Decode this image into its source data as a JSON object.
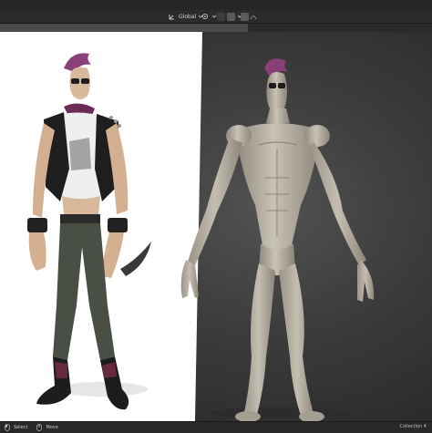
{
  "header": {
    "transform_orientation": "Global"
  },
  "statusbar": {
    "select_label": "Select",
    "move_label": "Move",
    "collection_label": "Collection 4"
  },
  "colors": {
    "reference_background": "#ffffff",
    "viewport_background": "#3a3a3a",
    "sculpt_clay": "#b9b3a6",
    "hair_accent": "#8a3f78",
    "ui_bar": "#2b2b2b"
  },
  "icons": {
    "orientation": "axis-gizmo-icon",
    "pivot": "pivot-point-icon",
    "snap": "magnet-snap-icon",
    "proportional": "proportional-edit-icon",
    "select": "mouse-left-icon",
    "move": "mouse-middle-icon"
  }
}
